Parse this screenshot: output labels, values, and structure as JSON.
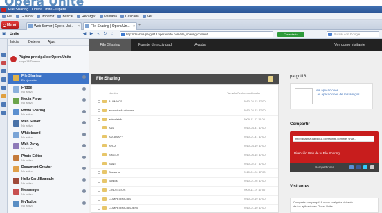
{
  "heading": "Opera Unite",
  "window": {
    "title": "File Sharing | Opera Unite - Opera"
  },
  "menu": [
    "Fiel",
    "Guardar",
    "Imprimir",
    "Buscar",
    "Recargar",
    "Ventana",
    "Cascada",
    "Ver"
  ],
  "tabs": {
    "opera_button": "Menú",
    "items": [
      {
        "label": "Web Server | Opera Uni..."
      },
      {
        "label": "File Sharing | Opera Un..."
      }
    ],
    "new_tab": "+"
  },
  "address": {
    "panel_label": "Unite",
    "url": "http://dharma.pargol18.operaunite.com/file_sharing/content/",
    "status": "Conectado",
    "search_placeholder": "Buscar con Google"
  },
  "panel": {
    "head": [
      "Iniciar",
      "Detener",
      "Ajust"
    ],
    "home_title": "Página principal de Opera Unite",
    "home_sub": "pargol18 Dharma",
    "services": [
      {
        "name": "File Sharing",
        "status": "En ejecución",
        "color": "#e1b34a",
        "selected": true
      },
      {
        "name": "Fridge",
        "status": "No activo",
        "color": "#8ab0dc"
      },
      {
        "name": "Media Player",
        "status": "No activo",
        "color": "#6ba44b"
      },
      {
        "name": "Photo Sharing",
        "status": "No activo",
        "color": "#5b8fcf"
      },
      {
        "name": "Web Server",
        "status": "No activo",
        "color": "#4a73a8"
      },
      {
        "name": "Whiteboard",
        "status": "No activo",
        "color": "#7aa4d6"
      },
      {
        "name": "Web Proxy",
        "status": "No activo",
        "color": "#8e7ab8"
      },
      {
        "name": "Photo Editor",
        "status": "No activo",
        "color": "#c47a3a"
      },
      {
        "name": "Document Creator",
        "status": "No activo",
        "color": "#e0a04a"
      },
      {
        "name": "Hello Card Example",
        "status": "No activo",
        "color": "#a04a3a"
      },
      {
        "name": "Messenger",
        "status": "No activo",
        "color": "#c85050"
      },
      {
        "name": "MyTodos",
        "status": "No activo",
        "color": "#5a8ec4"
      }
    ]
  },
  "page_nav": {
    "items": [
      "File Sharing",
      "Fuente de actividad",
      "Ayuda"
    ],
    "right": "Ver como visitante"
  },
  "file_sharing": {
    "title": "File Sharing",
    "columns": {
      "name": "Nombre",
      "size_date": "Tamaño Fecha modificado"
    },
    "rows": [
      {
        "name": "ALUMNOS",
        "date": "2010-03-03 17:00"
      },
      {
        "name": "android sdk windows",
        "date": "2010-03-22 17:00"
      },
      {
        "name": "animalsinfo",
        "date": "2009-11-27 11:00"
      },
      {
        "name": "ANS",
        "date": "2010-03-31 17:00"
      },
      {
        "name": "AULASAPY",
        "date": "2010-01-31 17:00"
      },
      {
        "name": "AVILA",
        "date": "2010-03-19 17:00"
      },
      {
        "name": "BINGO2",
        "date": "2010-05-15 17:00"
      },
      {
        "name": "BNNI",
        "date": "2010-02-07 17:00"
      },
      {
        "name": "Bhasana",
        "date": "2010-01-26 17:00"
      },
      {
        "name": "camios",
        "date": "2010-01-26 17:00"
      },
      {
        "name": "CINDELCIOS",
        "date": "2009-11-19 17:00"
      },
      {
        "name": "COMPETENCIAS",
        "date": "2010-02-19 17:00"
      },
      {
        "name": "COMPETENCIASDEF0",
        "date": "2010-01-10 17:00"
      }
    ]
  },
  "sidebar": {
    "user": "pargol18",
    "links": [
      "Mis aplicaciones",
      "Las aplicaciones de mis amigos"
    ],
    "share_title": "Compartir",
    "share_url": "http://dharma.pargol18.operaunite.com/file_shari...",
    "share_desc": "Dirección Web de tu File Sharing",
    "share_bar": "Compartir con",
    "visitors_title": "Visitantes",
    "visitors_text": [
      "Comparte con pargol18 o con cualquier visitante",
      "de tus aplicaciones Opera Unite."
    ]
  }
}
